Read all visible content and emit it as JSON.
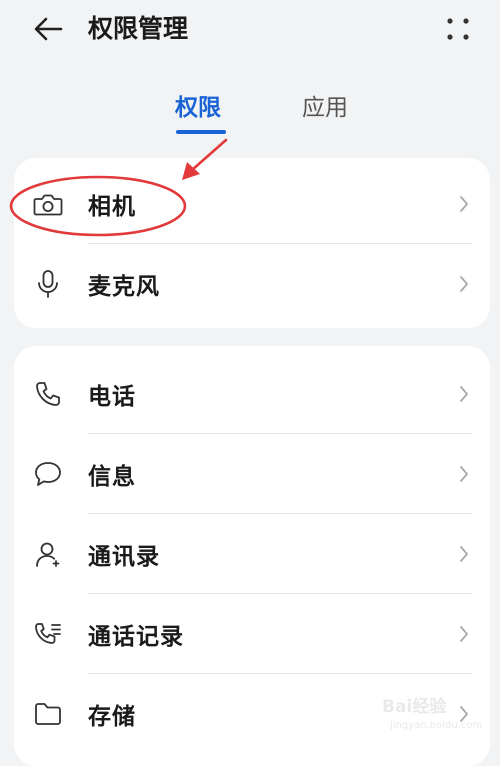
{
  "header": {
    "title": "权限管理",
    "back_icon": "arrow-left-icon",
    "more_icon": "grid-dots-icon"
  },
  "tabs": [
    {
      "label": "权限",
      "active": true
    },
    {
      "label": "应用",
      "active": false
    }
  ],
  "colors": {
    "accent": "#1a64d6",
    "background": "#f1f3f5",
    "card": "#ffffff",
    "annotation_red": "#e23a3a"
  },
  "groups": [
    {
      "items": [
        {
          "label": "相机",
          "icon": "camera-icon"
        },
        {
          "label": "麦克风",
          "icon": "microphone-icon"
        }
      ]
    },
    {
      "items": [
        {
          "label": "电话",
          "icon": "phone-icon"
        },
        {
          "label": "信息",
          "icon": "message-icon"
        },
        {
          "label": "通讯录",
          "icon": "contacts-icon"
        },
        {
          "label": "通话记录",
          "icon": "call-log-icon"
        },
        {
          "label": "存储",
          "icon": "folder-icon"
        }
      ]
    }
  ],
  "watermark": {
    "text": "Bai经验",
    "sub": "jingyan.baidu.com"
  }
}
